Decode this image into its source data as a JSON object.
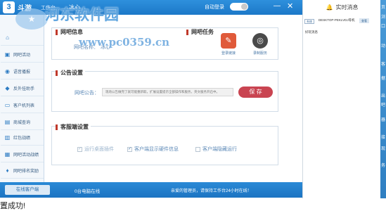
{
  "titlebar": {
    "logo_glyph": "3",
    "app_title": "斗游",
    "subtitle": "工作台",
    "username": "冰心",
    "autologin_label": "自动登录",
    "minimize_glyph": "—",
    "close_glyph": "✕"
  },
  "watermark": {
    "title": "河东软件园",
    "url": "www.pc0359.cn",
    "logo_glyph": "★"
  },
  "sidebar": {
    "items": [
      {
        "label": "",
        "icon": "home-icon",
        "glyph": "⌂"
      },
      {
        "label": "网吧活动",
        "icon": "activity-icon",
        "glyph": "▣"
      },
      {
        "label": "语音播报",
        "icon": "broadcast-icon",
        "glyph": "◉"
      },
      {
        "label": "反外挂助手",
        "icon": "shield-icon",
        "glyph": "◆"
      },
      {
        "label": "客户机列表",
        "icon": "computer-icon",
        "glyph": "▭"
      },
      {
        "label": "商城查询",
        "icon": "shop-icon",
        "glyph": "▤"
      },
      {
        "label": "红包战绩",
        "icon": "redpacket-icon",
        "glyph": "▥"
      },
      {
        "label": "网吧活动战绩",
        "icon": "trophy-icon",
        "glyph": "▦"
      },
      {
        "label": "网吧排名奖励",
        "icon": "medal-icon",
        "glyph": "♦"
      }
    ]
  },
  "main": {
    "netcafe_info": {
      "title": "网吧信息",
      "name_label": "网吧名称：",
      "name_value": "冰心"
    },
    "tasks": {
      "title": "网吧任务",
      "items": [
        {
          "label": "登录链接",
          "color": "#e05a3a",
          "glyph": "✎"
        },
        {
          "label": "录制服务",
          "color": "#4a4a4a",
          "glyph": "◎"
        }
      ]
    },
    "notice": {
      "title": "公告设置",
      "label": "网吧公告：",
      "value": "现场公告做完了就可能重新取，扩展设置提示全部操作和服务，英文服务开启中。",
      "save_label": "保 存"
    },
    "client_settings": {
      "title": "客服端设置",
      "options": [
        {
          "label": "运行桌面插件",
          "checked": true,
          "dimmed": true
        },
        {
          "label": "客户端显示硬件信息",
          "checked": true,
          "dimmed": false
        },
        {
          "label": "客户端隐藏运行",
          "checked": false,
          "dimmed": false
        }
      ]
    }
  },
  "bottombar": {
    "online_button": "在线客户端",
    "online_text": "0台电脑在线",
    "welcome_text": "亲爱的管理员，请保持工作台24小时在线！"
  },
  "right_panel": {
    "header": "实时消息",
    "bell_glyph": "🔔",
    "msg_tag": "系统",
    "msg_text": "DESKTOP-PEKLVDJ等机",
    "msg_button": "查看",
    "msg_sub": "好玩消息"
  },
  "far_right": {
    "chars": [
      "页",
      "浏",
      "口",
      "动",
      "客",
      "据",
      "出",
      "吧",
      "器",
      "接",
      "现",
      "务"
    ]
  },
  "bottom_status": {
    "text": "置成功!"
  }
}
